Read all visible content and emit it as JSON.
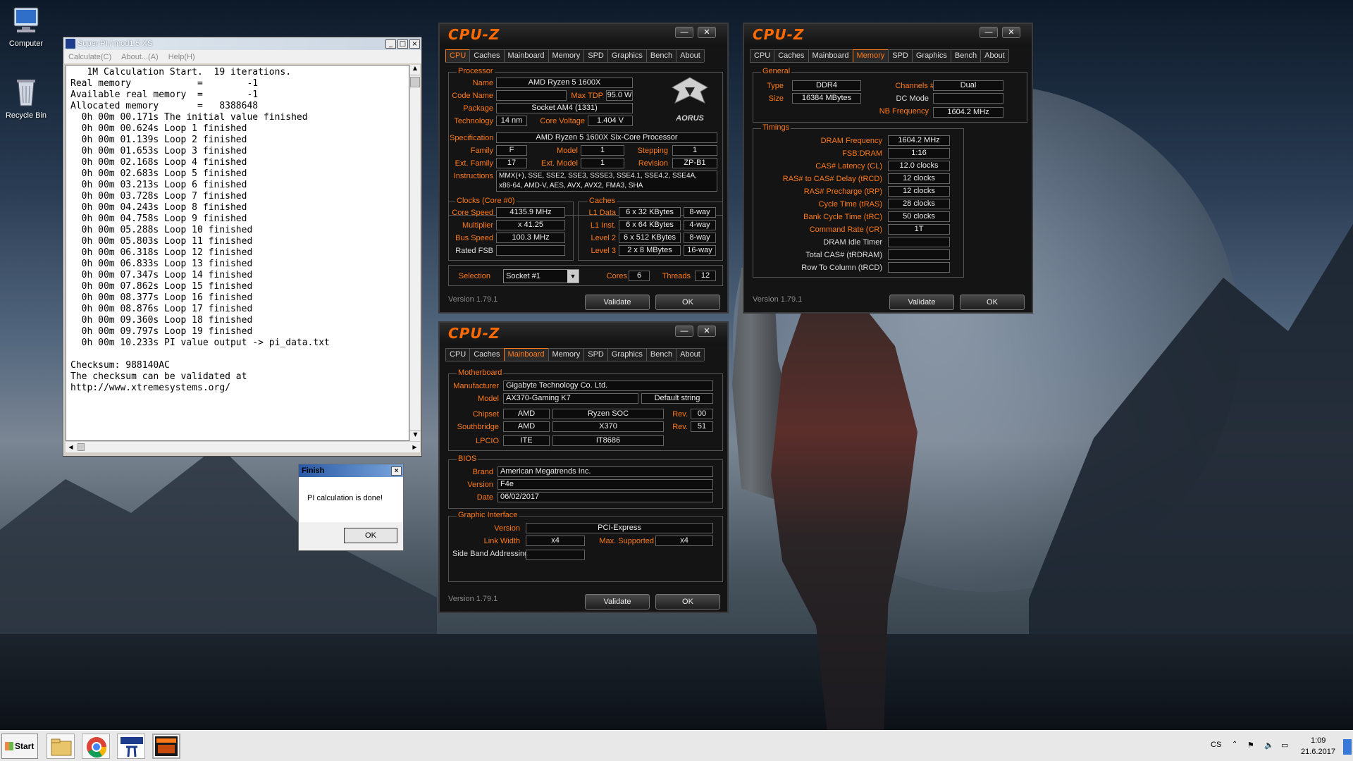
{
  "desktop": {
    "icons": [
      {
        "label": "Computer"
      },
      {
        "label": "Recycle Bin"
      }
    ]
  },
  "superpi": {
    "title": "Super PI / mod1.5 XS",
    "menu": [
      "Calculate(C)",
      "About...(A)",
      "Help(H)"
    ],
    "output": [
      "   1M Calculation Start.  19 iterations.",
      "Real memory            =        -1",
      "Available real memory  =        -1",
      "Allocated memory       =   8388648",
      "  0h 00m 00.171s The initial value finished",
      "  0h 00m 00.624s Loop 1 finished",
      "  0h 00m 01.139s Loop 2 finished",
      "  0h 00m 01.653s Loop 3 finished",
      "  0h 00m 02.168s Loop 4 finished",
      "  0h 00m 02.683s Loop 5 finished",
      "  0h 00m 03.213s Loop 6 finished",
      "  0h 00m 03.728s Loop 7 finished",
      "  0h 00m 04.243s Loop 8 finished",
      "  0h 00m 04.758s Loop 9 finished",
      "  0h 00m 05.288s Loop 10 finished",
      "  0h 00m 05.803s Loop 11 finished",
      "  0h 00m 06.318s Loop 12 finished",
      "  0h 00m 06.833s Loop 13 finished",
      "  0h 00m 07.347s Loop 14 finished",
      "  0h 00m 07.862s Loop 15 finished",
      "  0h 00m 08.377s Loop 16 finished",
      "  0h 00m 08.876s Loop 17 finished",
      "  0h 00m 09.360s Loop 18 finished",
      "  0h 00m 09.797s Loop 19 finished",
      "  0h 00m 10.233s PI value output -> pi_data.txt",
      "",
      "Checksum: 988140AC",
      "The checksum can be validated at",
      "http://www.xtremesystems.org/"
    ]
  },
  "finish": {
    "title": "Finish",
    "message": "PI calculation is done!",
    "ok": "OK"
  },
  "cpuz_common": {
    "logo": "CPU-Z",
    "version": "Version 1.79.1",
    "validate": "Validate",
    "ok": "OK",
    "tabs": [
      "CPU",
      "Caches",
      "Mainboard",
      "Memory",
      "SPD",
      "Graphics",
      "Bench",
      "About"
    ],
    "minimize": "—",
    "close": "✕"
  },
  "cpu": {
    "processor_group": "Processor",
    "name_label": "Name",
    "name": "AMD Ryzen 5 1600X",
    "codename_label": "Code Name",
    "codename": "",
    "maxtdp_label": "Max TDP",
    "maxtdp": "95.0 W",
    "package_label": "Package",
    "package": "Socket AM4 (1331)",
    "technology_label": "Technology",
    "technology": "14 nm",
    "corevoltage_label": "Core Voltage",
    "corevoltage": "1.404 V",
    "brand_logo": "AORUS",
    "specification_label": "Specification",
    "specification": "AMD Ryzen 5 1600X Six-Core Processor",
    "family_label": "Family",
    "family": "F",
    "model_label": "Model",
    "model": "1",
    "stepping_label": "Stepping",
    "stepping": "1",
    "extfamily_label": "Ext. Family",
    "extfamily": "17",
    "extmodel_label": "Ext. Model",
    "extmodel": "1",
    "revision_label": "Revision",
    "revision": "ZP-B1",
    "instructions_label": "Instructions",
    "instructions_1": "MMX(+), SSE, SSE2, SSE3, SSSE3, SSE4.1, SSE4.2, SSE4A,",
    "instructions_2": "x86-64, AMD-V, AES, AVX, AVX2, FMA3, SHA",
    "clocks_group": "Clocks (Core #0)",
    "corespeed_label": "Core Speed",
    "corespeed": "4135.9 MHz",
    "multiplier_label": "Multiplier",
    "multiplier": "x 41.25",
    "busspeed_label": "Bus Speed",
    "busspeed": "100.3 MHz",
    "ratedfsb_label": "Rated FSB",
    "ratedfsb": "",
    "caches_group": "Caches",
    "l1data_label": "L1 Data",
    "l1data": "6 x 32 KBytes",
    "l1data_way": "8-way",
    "l1inst_label": "L1 Inst.",
    "l1inst": "6 x 64 KBytes",
    "l1inst_way": "4-way",
    "level2_label": "Level 2",
    "level2": "6 x 512 KBytes",
    "level2_way": "8-way",
    "level3_label": "Level 3",
    "level3": "2 x 8 MBytes",
    "level3_way": "16-way",
    "selection_label": "Selection",
    "selection": "Socket #1",
    "cores_label": "Cores",
    "cores": "6",
    "threads_label": "Threads",
    "threads": "12"
  },
  "memory": {
    "general_group": "General",
    "type_label": "Type",
    "type": "DDR4",
    "channels_label": "Channels #",
    "channels": "Dual",
    "size_label": "Size",
    "size": "16384 MBytes",
    "dcmode_label": "DC Mode",
    "dcmode": "",
    "nbfreq_label": "NB Frequency",
    "nbfreq": "1604.2 MHz",
    "timings_group": "Timings",
    "timings": [
      {
        "label": "DRAM Frequency",
        "value": "1604.2 MHz",
        "white": false
      },
      {
        "label": "FSB:DRAM",
        "value": "1:16",
        "white": false
      },
      {
        "label": "CAS# Latency (CL)",
        "value": "12.0 clocks",
        "white": false
      },
      {
        "label": "RAS# to CAS# Delay (tRCD)",
        "value": "12 clocks",
        "white": false
      },
      {
        "label": "RAS# Precharge (tRP)",
        "value": "12 clocks",
        "white": false
      },
      {
        "label": "Cycle Time (tRAS)",
        "value": "28 clocks",
        "white": false
      },
      {
        "label": "Bank Cycle Time (tRC)",
        "value": "50 clocks",
        "white": false
      },
      {
        "label": "Command Rate (CR)",
        "value": "1T",
        "white": false
      },
      {
        "label": "DRAM Idle Timer",
        "value": "",
        "white": true
      },
      {
        "label": "Total CAS# (tRDRAM)",
        "value": "",
        "white": true
      },
      {
        "label": "Row To Column (tRCD)",
        "value": "",
        "white": true
      }
    ]
  },
  "mainboard": {
    "motherboard_group": "Motherboard",
    "manufacturer_label": "Manufacturer",
    "manufacturer": "Gigabyte Technology Co. Ltd.",
    "model_label": "Model",
    "model": "AX370-Gaming K7",
    "model_extra": "Default string",
    "chipset_label": "Chipset",
    "chipset_vendor": "AMD",
    "chipset_name": "Ryzen SOC",
    "chipset_rev_label": "Rev.",
    "chipset_rev": "00",
    "southbridge_label": "Southbridge",
    "sb_vendor": "AMD",
    "sb_name": "X370",
    "sb_rev_label": "Rev.",
    "sb_rev": "51",
    "lpcio_label": "LPCIO",
    "lpcio_vendor": "ITE",
    "lpcio_name": "IT8686",
    "bios_group": "BIOS",
    "brand_label": "Brand",
    "brand": "American Megatrends Inc.",
    "version_label": "Version",
    "version": "F4e",
    "date_label": "Date",
    "date": "06/02/2017",
    "graphic_group": "Graphic Interface",
    "gi_version_label": "Version",
    "gi_version": "PCI-Express",
    "linkwidth_label": "Link Width",
    "linkwidth": "x4",
    "maxsupported_label": "Max. Supported",
    "maxsupported": "x4",
    "sideband_label": "Side Band Addressing",
    "sideband": ""
  },
  "taskbar": {
    "start": "Start",
    "lang": "CS",
    "time": "1:09",
    "date": "21.6.2017"
  }
}
